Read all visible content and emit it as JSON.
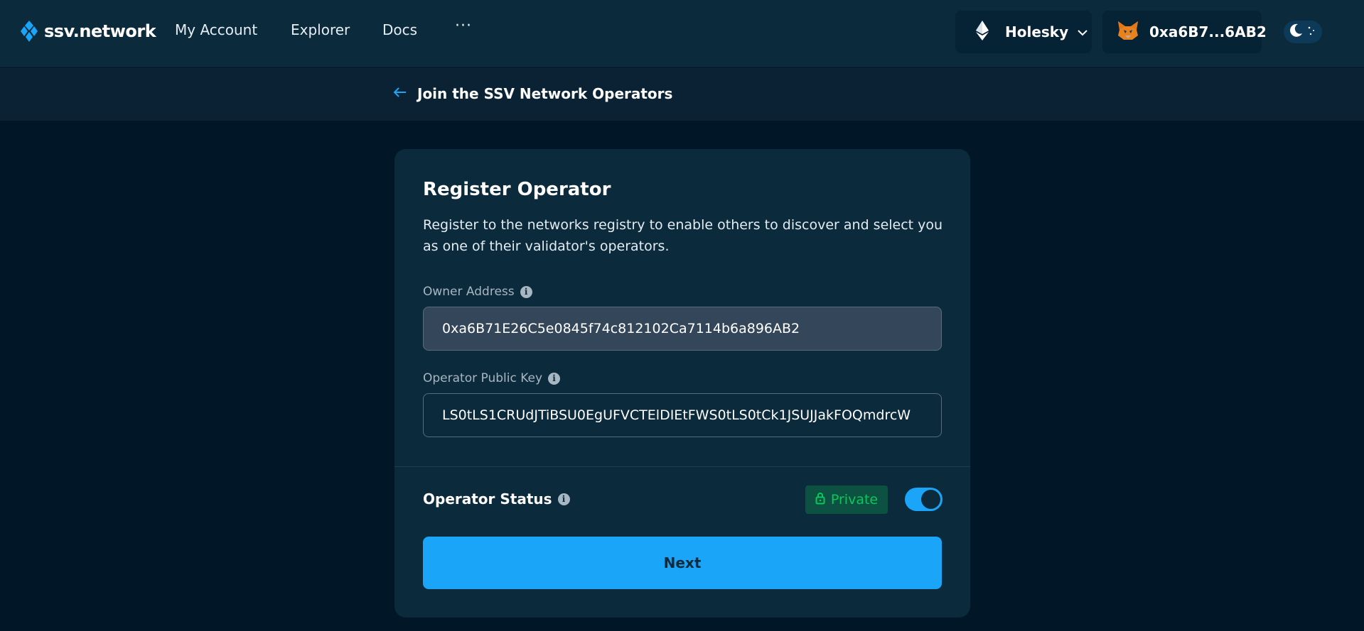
{
  "brand": {
    "name": "ssv.network"
  },
  "nav": {
    "links": [
      "My Account",
      "Explorer",
      "Docs"
    ],
    "more": "···"
  },
  "network": {
    "label": "Holesky",
    "icon": "ethereum-icon"
  },
  "wallet": {
    "address": "0xa6B7...6AB2",
    "icon": "metamask-fox-icon"
  },
  "theme": {
    "icon": "moon-icon"
  },
  "back": {
    "label": "Join the SSV Network Operators"
  },
  "card": {
    "title": "Register Operator",
    "description": "Register to the networks registry to enable others to discover and select you as one of their validator's operators.",
    "owner_label": "Owner Address",
    "owner_value": "0xa6B71E26C5e0845f74c812102Ca7114b6a896AB2",
    "key_label": "Operator Public Key",
    "key_value": "LS0tLS1CRUdJTiBSU0EgUFVCTElDIEtFWS0tLS0tCk1JSUJJakFOQmdrcW",
    "status_label": "Operator Status",
    "status_badge": "Private",
    "status_toggle_on": true,
    "next_label": "Next"
  },
  "colors": {
    "background": "#011627",
    "card": "#0B2A3C",
    "accent": "#1BA5F8",
    "private_text": "#08C858",
    "private_bg": "#0D5143"
  }
}
